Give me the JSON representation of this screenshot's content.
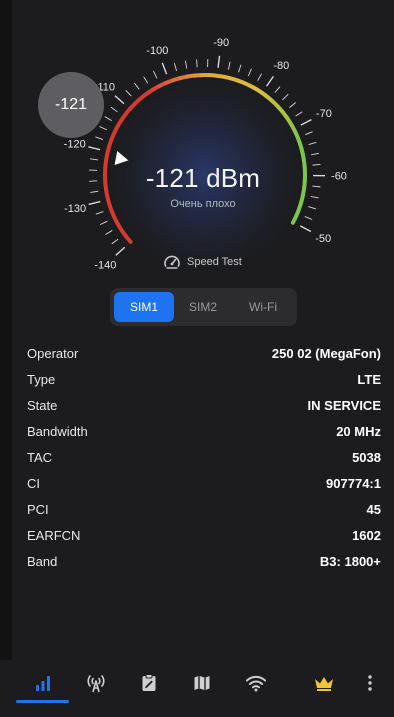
{
  "gauge": {
    "scale_labels": [
      "-140",
      "-130",
      "-120",
      "-110",
      "-100",
      "-90",
      "-80",
      "-70",
      "-60",
      "-50"
    ],
    "current_value": "-121",
    "reading": "-121 dBm",
    "quality": "Очень плохо",
    "level_dbm": -121,
    "colors": {
      "low": "#d43a32",
      "mid": "#e5a53a",
      "high": "#7cc64a",
      "pointer": "#ffffff"
    }
  },
  "speed_test": {
    "label": "Speed Test",
    "icon": "speedometer-icon"
  },
  "sim_tabs": [
    {
      "label": "SIM1",
      "active": true
    },
    {
      "label": "SIM2",
      "active": false
    },
    {
      "label": "Wi-Fi",
      "active": false
    }
  ],
  "info": [
    {
      "label": "Operator",
      "value": "250 02 (MegaFon)"
    },
    {
      "label": "Type",
      "value": "LTE"
    },
    {
      "label": "State",
      "value": "IN SERVICE"
    },
    {
      "label": "Bandwidth",
      "value": "20 MHz"
    },
    {
      "label": "TAC",
      "value": "5038"
    },
    {
      "label": "CI",
      "value": "907774:1"
    },
    {
      "label": "PCI",
      "value": "45"
    },
    {
      "label": "EARFCN",
      "value": "1602"
    },
    {
      "label": "Band",
      "value": "B3: 1800+"
    }
  ],
  "nav": [
    {
      "icon": "signal-bars-icon",
      "active": true
    },
    {
      "icon": "antenna-icon",
      "active": false
    },
    {
      "icon": "clipboard-icon",
      "active": false
    },
    {
      "icon": "map-icon",
      "active": false
    },
    {
      "icon": "wifi-icon",
      "active": false
    },
    {
      "icon": "crown-icon",
      "active": false
    },
    {
      "icon": "more-vertical-icon",
      "active": false
    }
  ],
  "theme": {
    "accent": "#1e73f0",
    "background": "#1c1c1e",
    "crown": "#f2c531"
  }
}
